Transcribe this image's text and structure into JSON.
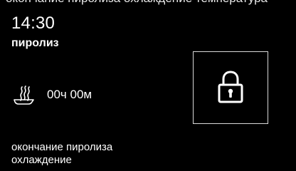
{
  "header": {
    "clipped_text": "окончание пиролиза охлаждение  температура",
    "time": "14:30",
    "mode": "пиролиз"
  },
  "timer": {
    "icon": "steam-pan-icon",
    "value": "00ч 00м"
  },
  "lock": {
    "icon": "padlock-icon"
  },
  "status": {
    "line1": "окончание пиролиза",
    "line2": "охлаждение"
  },
  "colors": {
    "background": "#000000",
    "text": "#ffffff",
    "border": "#d9d9d9"
  }
}
